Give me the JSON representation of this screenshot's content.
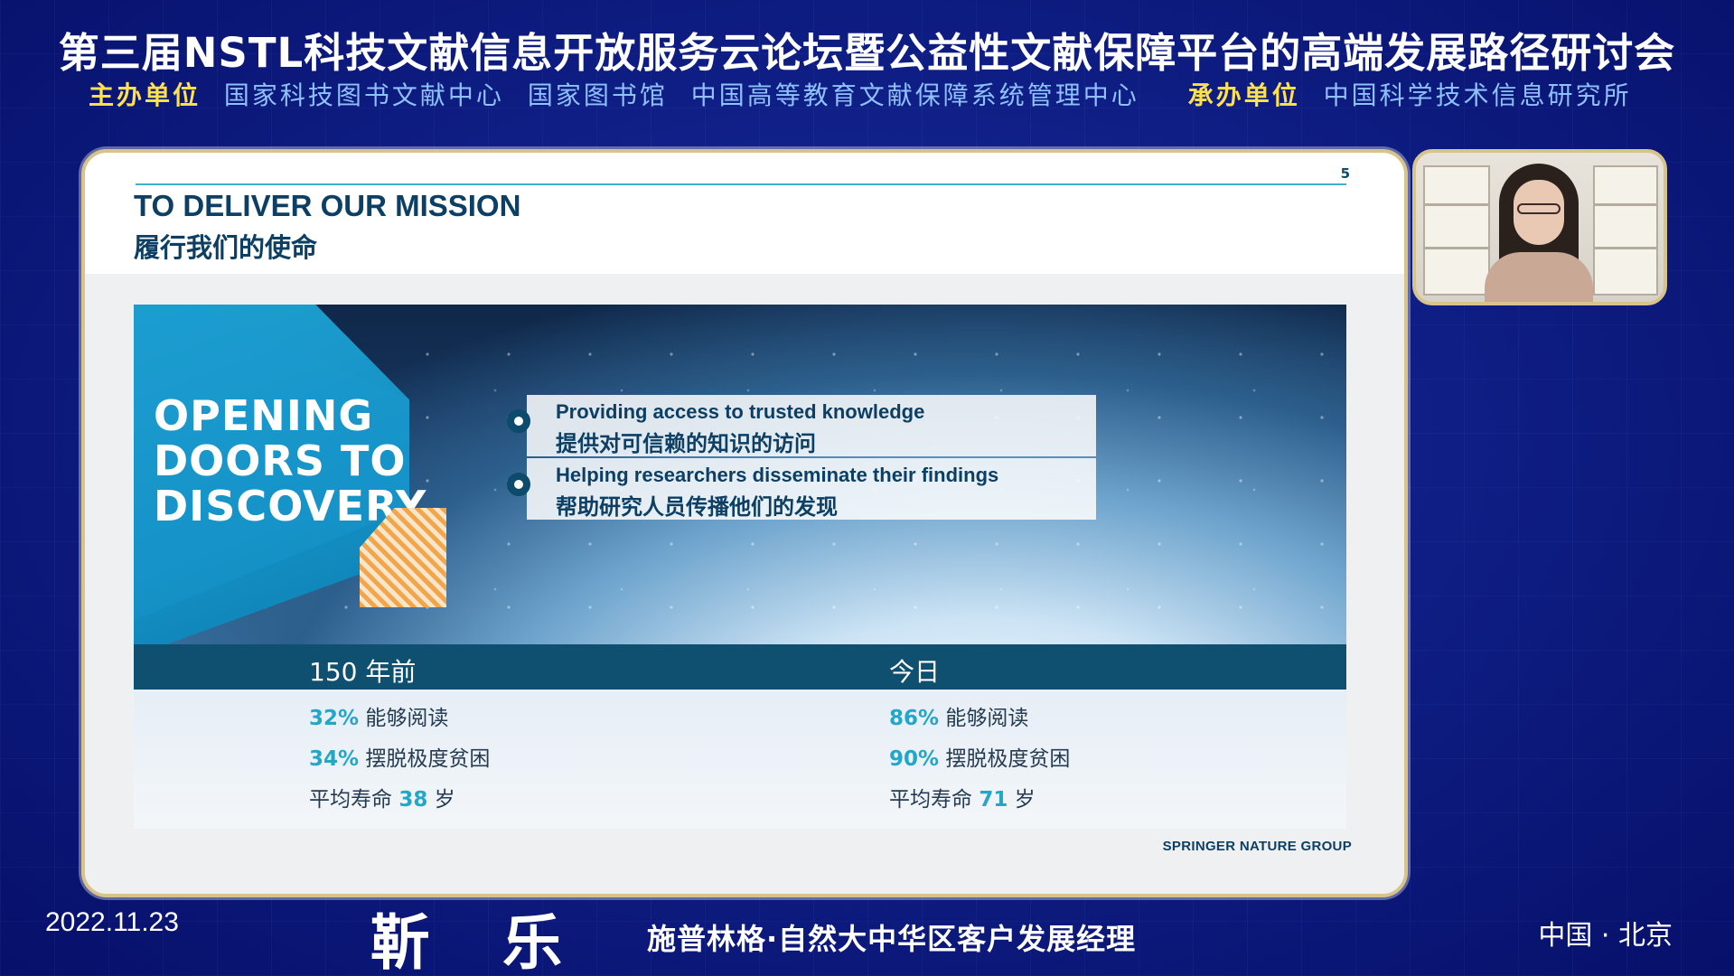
{
  "header": {
    "title": "第三届NSTL科技文献信息开放服务云论坛暨公益性文献保障平台的高端发展路径研讨会",
    "host_label": "主办单位",
    "hosts": [
      "国家科技图书文献中心",
      "国家图书馆",
      "中国高等教育文献保障系统管理中心"
    ],
    "organizer_label": "承办单位",
    "organizer": "中国科学技术信息研究所"
  },
  "slide": {
    "page_number": "5",
    "title_en": "TO DELIVER OUR MISSION",
    "title_cn": "履行我们的使命",
    "hero_text": "OPENING DOORS TO DISCOVERY",
    "bullets": [
      {
        "en": "Providing access to trusted knowledge",
        "cn": "提供对可信赖的知识的访问"
      },
      {
        "en": "Helping researchers disseminate their findings",
        "cn": "帮助研究人员传播他们的发现"
      }
    ],
    "stats": {
      "left_header": "150 年前",
      "right_header": "今日",
      "left": [
        {
          "num": "32%",
          "text": "能够阅读"
        },
        {
          "num": "34%",
          "text": "摆脱极度贫困"
        },
        {
          "pre": "平均寿命",
          "num": "38",
          "post": "岁"
        }
      ],
      "right": [
        {
          "num": "86%",
          "text": "能够阅读"
        },
        {
          "num": "90%",
          "text": "摆脱极度贫困"
        },
        {
          "pre": "平均寿命",
          "num": "71",
          "post": "岁"
        }
      ]
    },
    "brand": "SPRINGER NATURE GROUP"
  },
  "footer": {
    "date": "2022.11.23",
    "speaker_name": "靳乐",
    "speaker_role": "施普林格·自然大中华区客户发展经理",
    "location": "中国 · 北京"
  },
  "colors": {
    "background": "#0f1f86",
    "accent_yellow": "#ffe14d",
    "accent_light_blue": "#8fc0ff",
    "slide_navy": "#0c3f63",
    "slide_teal": "#23a7c9"
  }
}
